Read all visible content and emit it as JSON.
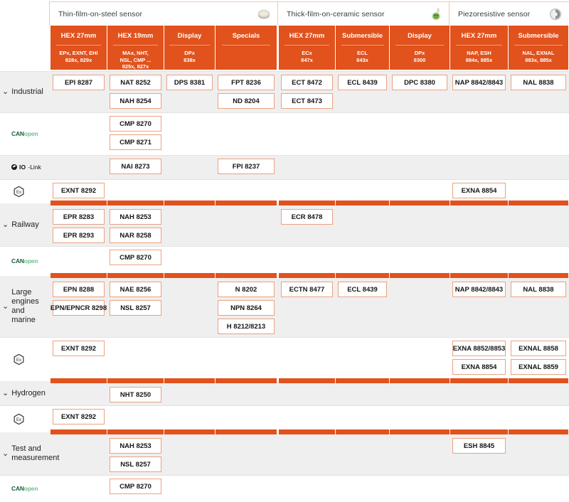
{
  "groups": [
    {
      "title": "Thin-film-on-steel sensor",
      "icon": "steel-sensor-image"
    },
    {
      "title": "Thick-film-on-ceramic sensor",
      "icon": "ceramic-sensor-image"
    },
    {
      "title": "Piezoresistive sensor",
      "icon": "piezoresistive-sensor-image"
    }
  ],
  "columns": [
    {
      "title": "HEX 27mm",
      "sub": "EPx, EXNT, EHI\n828x, 829x"
    },
    {
      "title": "HEX 19mm",
      "sub": "MAx, NHT,\nNSL, CMP ...\n825x, 827x"
    },
    {
      "title": "Display",
      "sub": "DPx\n838x"
    },
    {
      "title": "Specials",
      "sub": ""
    },
    {
      "title": "HEX 27mm",
      "sub": "ECx\n847x"
    },
    {
      "title": "Submersible",
      "sub": "ECL\n843x"
    },
    {
      "title": "Display",
      "sub": "DPx\n8300"
    },
    {
      "title": "HEX 27mm",
      "sub": "NAP, ESH\n884x, 885x"
    },
    {
      "title": "Submersible",
      "sub": "NAL, EXNAL\n883x, 885x"
    }
  ],
  "rows": [
    {
      "label": "Industrial",
      "label_type": "text",
      "expandable": true,
      "cells": [
        [
          "EPI 8287"
        ],
        [
          "NAT 8252",
          "NAH 8254"
        ],
        [
          "DPS 8381"
        ],
        [
          "FPT 8236",
          "ND 8204"
        ],
        [
          "ECT 8472",
          "ECT 8473"
        ],
        [
          "ECL 8439"
        ],
        [
          "DPC 8380"
        ],
        [
          "NAP 8842/8843"
        ],
        [
          "NAL 8838"
        ]
      ]
    },
    {
      "label": "CANopen",
      "label_type": "canopen",
      "expandable": false,
      "cells": [
        [],
        [
          "CMP 8270",
          "CMP 8271"
        ],
        [],
        [],
        [],
        [],
        [],
        [],
        []
      ]
    },
    {
      "label": "IO-Link",
      "label_type": "iolink",
      "expandable": false,
      "cells": [
        [],
        [
          "NAI 8273"
        ],
        [],
        [
          "FPI 8237"
        ],
        [],
        [],
        [],
        [],
        []
      ]
    },
    {
      "label": "Ex",
      "label_type": "ex",
      "expandable": false,
      "cells": [
        [
          "EXNT 8292"
        ],
        [],
        [],
        [],
        [],
        [],
        [],
        [
          "EXNA 8854"
        ],
        []
      ]
    },
    {
      "label": "Railway",
      "label_type": "text",
      "expandable": true,
      "cells": [
        [
          "EPR 8283",
          "EPR 8293"
        ],
        [
          "NAH 8253",
          "NAR 8258"
        ],
        [],
        [],
        [
          "ECR 8478"
        ],
        [],
        [],
        [],
        []
      ]
    },
    {
      "label": "CANopen",
      "label_type": "canopen",
      "expandable": false,
      "cells": [
        [],
        [
          "CMP 8270"
        ],
        [],
        [],
        [],
        [],
        [],
        [],
        []
      ]
    },
    {
      "label": "Large\nengines\nand marine",
      "label_type": "text",
      "expandable": true,
      "cells": [
        [
          "EPN 8288",
          "EPN/EPNCR 8298"
        ],
        [
          "NAE 8256",
          "NSL 8257"
        ],
        [],
        [
          "N 8202",
          "NPN 8264",
          "H 8212/8213"
        ],
        [
          "ECTN 8477"
        ],
        [
          "ECL 8439"
        ],
        [],
        [
          "NAP 8842/8843"
        ],
        [
          "NAL 8838"
        ]
      ]
    },
    {
      "label": "Ex",
      "label_type": "ex",
      "expandable": false,
      "cells": [
        [
          "EXNT 8292"
        ],
        [],
        [],
        [],
        [],
        [],
        [],
        [
          "EXNA 8852/8853",
          "EXNA 8854"
        ],
        [
          "EXNAL 8858",
          "EXNAL 8859"
        ]
      ]
    },
    {
      "label": "Hydrogen",
      "label_type": "text",
      "expandable": true,
      "cells": [
        [],
        [
          "NHT 8250"
        ],
        [],
        [],
        [],
        [],
        [],
        [],
        []
      ]
    },
    {
      "label": "Ex",
      "label_type": "ex",
      "expandable": false,
      "cells": [
        [
          "EXNT 8292"
        ],
        [],
        [],
        [],
        [],
        [],
        [],
        [],
        []
      ]
    },
    {
      "label": "Test and\nmeasurement",
      "label_type": "text",
      "expandable": true,
      "cells": [
        [],
        [
          "NAH 8253",
          "NSL 8257"
        ],
        [],
        [],
        [],
        [],
        [],
        [
          "ESH 8845"
        ],
        []
      ]
    },
    {
      "label": "CANopen",
      "label_type": "canopen",
      "expandable": false,
      "cells": [
        [],
        [
          "CMP 8270"
        ],
        [],
        [],
        [],
        [],
        [],
        [],
        []
      ]
    }
  ],
  "logos": {
    "canopen_can": "CAN",
    "canopen_open": "open",
    "iolink_io": "IO",
    "iolink_link": "-Link"
  },
  "colors": {
    "accent": "#e1521d",
    "chip_border": "#eba181",
    "row_grey": "#efefef",
    "canopen_dark": "#1d5c3f",
    "canopen_green": "#6cbf8a"
  },
  "caret": "⌄"
}
